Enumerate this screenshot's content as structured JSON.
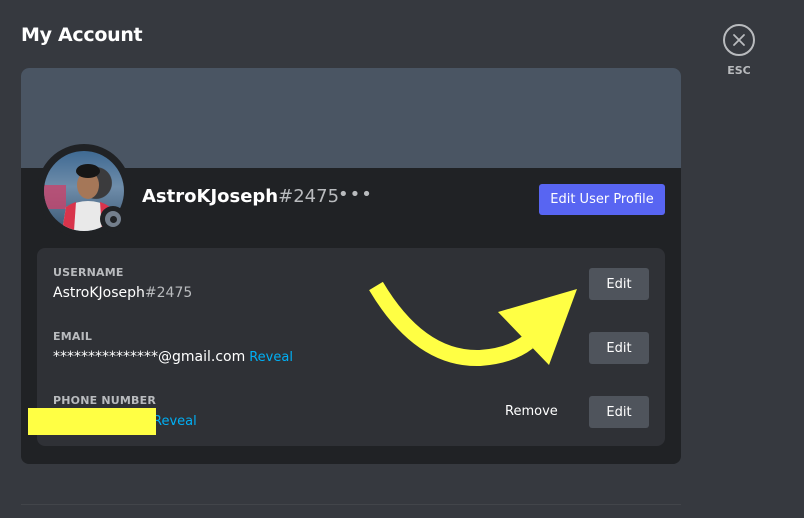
{
  "page": {
    "title": "My Account"
  },
  "close": {
    "icon": "close-icon",
    "label": "ESC"
  },
  "profile": {
    "username": "AstroKJoseph",
    "discriminator": "#2475",
    "more_icon": "•••",
    "edit_profile_label": "Edit User Profile",
    "status": "offline",
    "banner_color": "#4a5563",
    "accent_color": "#5865f2"
  },
  "fields": {
    "username": {
      "label": "USERNAME",
      "value": "AstroKJoseph",
      "discriminator": "#2475",
      "edit_label": "Edit"
    },
    "email": {
      "label": "EMAIL",
      "value": "***************@gmail.com",
      "reveal_label": "Reveal",
      "edit_label": "Edit"
    },
    "phone": {
      "label": "PHONE NUMBER",
      "value": "",
      "reveal_label": "Reveal",
      "remove_label": "Remove",
      "edit_label": "Edit"
    }
  },
  "annotation": {
    "arrow_color": "#ffff44",
    "redaction_color": "#ffff44"
  }
}
